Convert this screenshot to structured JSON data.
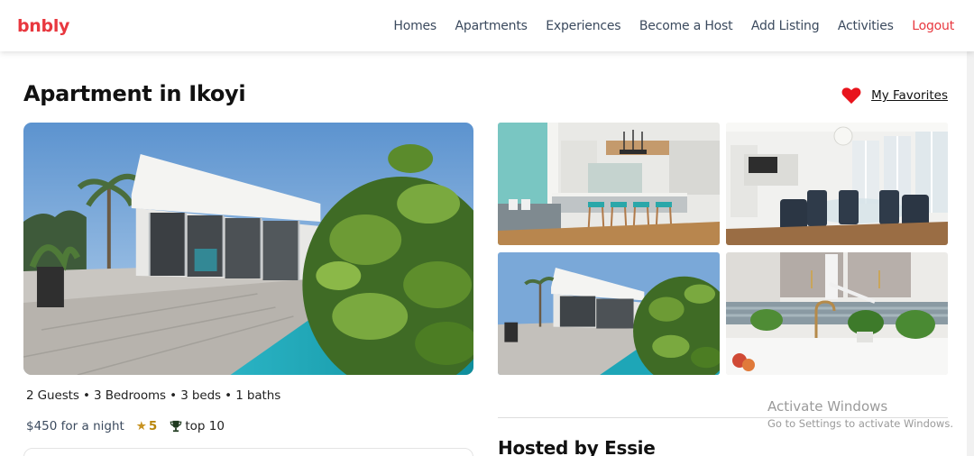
{
  "brand": "bnbly",
  "nav": {
    "homes": "Homes",
    "apartments": "Apartments",
    "experiences": "Experiences",
    "become_host": "Become a Host",
    "add_listing": "Add Listing",
    "activities": "Activities",
    "logout": "Logout"
  },
  "listing": {
    "title": "Apartment in Ikoyi",
    "favorites_label": "My Favorites",
    "specs": "2 Guests • 3 Bedrooms • 3 beds • 1 baths",
    "price": "$450 for a night",
    "rating": "5",
    "badge": "top 10",
    "hosted_by": "Hosted by Essie"
  },
  "images": {
    "hero": "villa-exterior-pool",
    "thumb_1": "kitchen-living-room",
    "thumb_2": "dining-room",
    "thumb_3": "villa-exterior-pool",
    "thumb_4": "kitchen-sink-plants"
  },
  "watermark": {
    "title": "Activate Windows",
    "subtitle": "Go to Settings to activate Windows."
  },
  "colors": {
    "brand": "#e8383f",
    "nav_text": "#3b4a5e",
    "star": "#c89322",
    "heart": "#e8141c"
  }
}
